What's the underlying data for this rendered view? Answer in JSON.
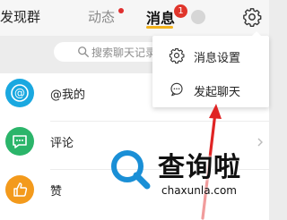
{
  "topbar": {
    "discover_label": "发现群",
    "dynamic_label": "动态",
    "message_label": "消息",
    "message_badge": "1",
    "icons": [
      "gear-icon"
    ],
    "accent_color": "#f2b21b",
    "badge_color": "#e0352b"
  },
  "search": {
    "placeholder": "搜索聊天记录"
  },
  "list": {
    "items": [
      {
        "label": "@我的",
        "icon": "at-icon",
        "color": "#1aa8e0"
      },
      {
        "label": "评论",
        "icon": "comment-icon",
        "color": "#2bb56a"
      },
      {
        "label": "赞",
        "icon": "thumb-up-icon",
        "color": "#f39a1c"
      }
    ]
  },
  "popup": {
    "items": [
      {
        "label": "消息设置",
        "icon": "gear-icon"
      },
      {
        "label": "发起聊天",
        "icon": "chat-bubble-icon"
      }
    ]
  },
  "annotation": {
    "arrow_color": "#e02424"
  },
  "watermark": {
    "text": "查询啦",
    "url": "chaxunla.com"
  }
}
